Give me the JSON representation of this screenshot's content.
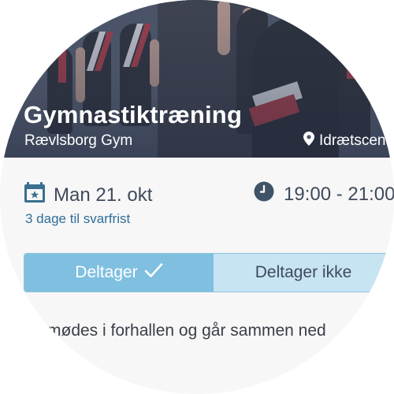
{
  "event": {
    "title": "Gymnastiktræning",
    "group": "Rævlsborg Gym",
    "location": "Idrætscen",
    "location_icon": "map-pin-icon",
    "date": "Man 21. okt",
    "date_icon": "calendar-icon",
    "time": "19:00 - 21:00",
    "time_icon": "clock-icon",
    "deadline": "3 dage til svarfrist"
  },
  "rsvp": {
    "attending_label": "Deltager",
    "attending_icon": "checkmark-icon",
    "not_attending_label": "Deltager ikke",
    "selected": "attending"
  },
  "description": "mødes i forhallen og går sammen ned"
}
